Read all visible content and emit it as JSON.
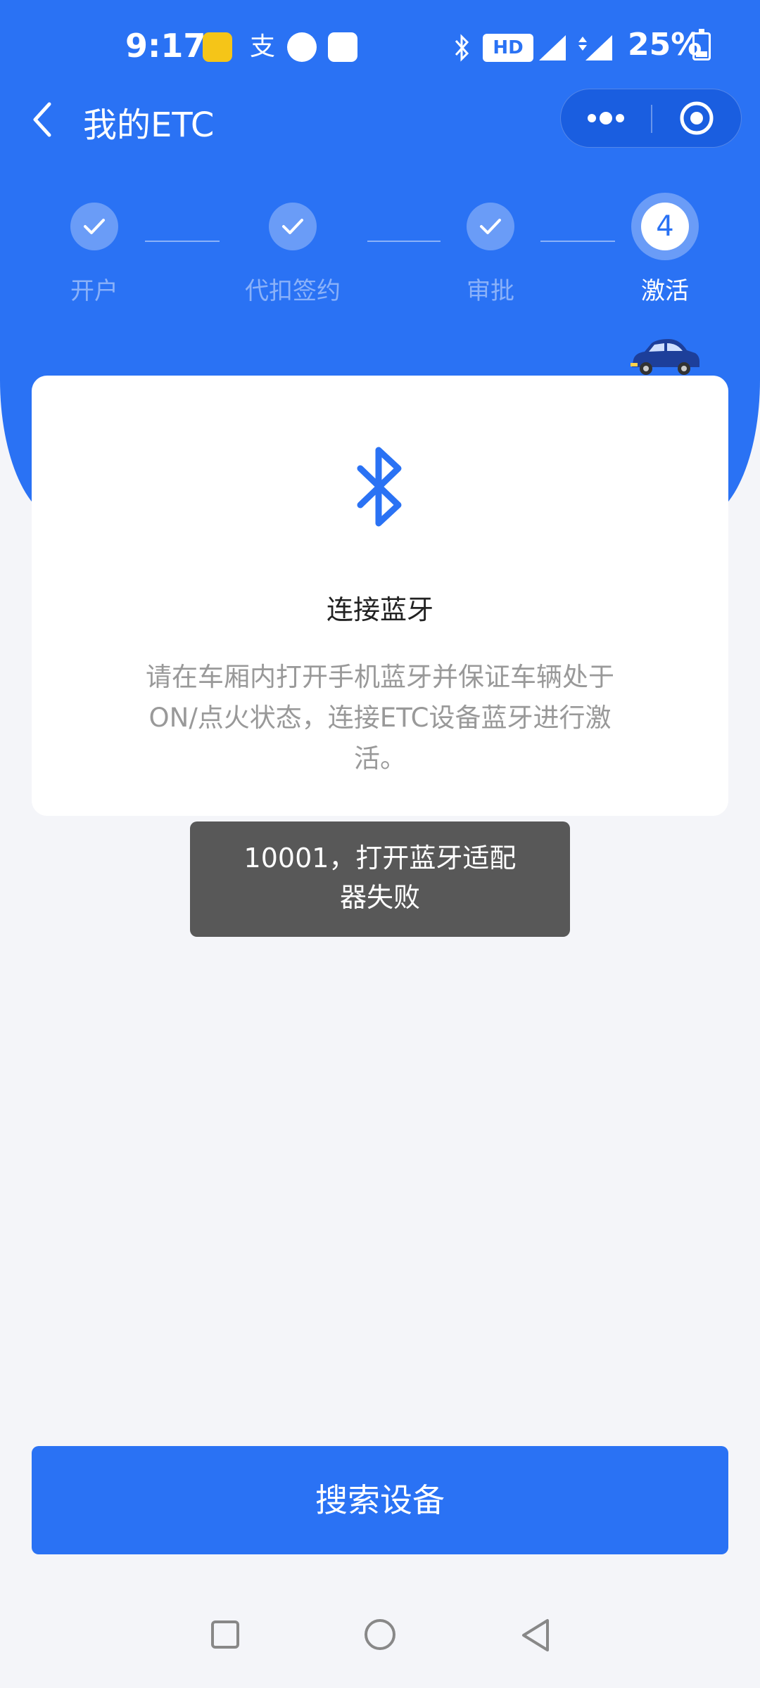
{
  "status_bar": {
    "time": "9:17",
    "hd_label": "HD",
    "battery_percent": "25%",
    "icons": [
      "taxi-app-icon",
      "alipay-icon",
      "video-app-icon",
      "red-app-icon",
      "bluetooth-icon",
      "signal-4g-icon",
      "signal-4g-icon",
      "battery-icon"
    ]
  },
  "header": {
    "title": "我的ETC",
    "back_icon": "chevron-left-icon",
    "capsule": {
      "more_icon": "more-dots-icon",
      "close_icon": "target-circle-icon"
    }
  },
  "stepper": {
    "steps": [
      {
        "label": "开户",
        "state": "done"
      },
      {
        "label": "代扣签约",
        "state": "done"
      },
      {
        "label": "审批",
        "state": "done"
      },
      {
        "label": "激活",
        "state": "active",
        "number": "4"
      }
    ]
  },
  "card": {
    "icon": "bluetooth-icon",
    "title": "连接蓝牙",
    "description": "请在车厢内打开手机蓝牙并保证车辆处于ON/点火状态，连接ETC设备蓝牙进行激活。"
  },
  "toast": {
    "message": "10001，打开蓝牙适配器失败"
  },
  "actions": {
    "search_button": "搜索设备"
  },
  "colors": {
    "primary": "#2a72f4",
    "background": "#f4f5f9",
    "toast_bg": "#585858"
  }
}
